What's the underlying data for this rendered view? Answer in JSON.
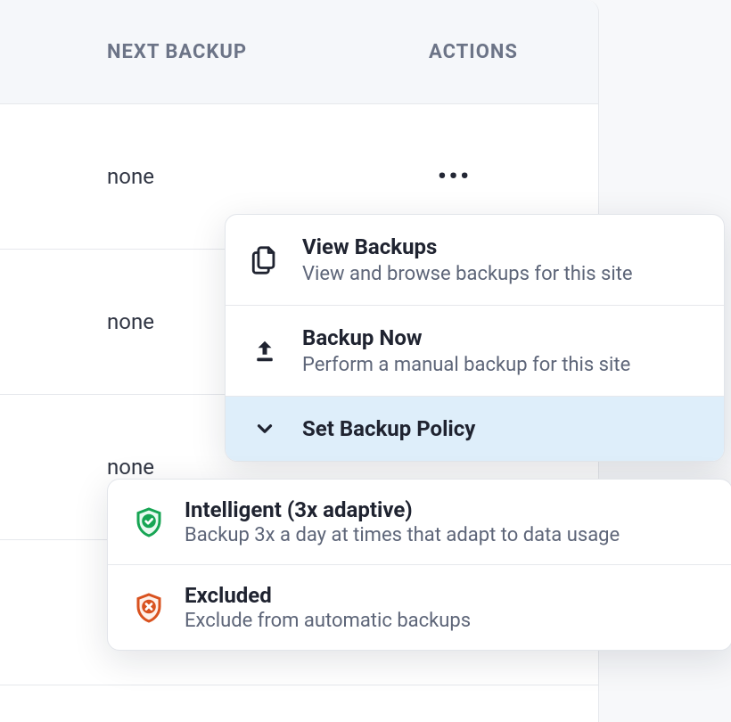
{
  "table": {
    "headers": {
      "next_backup": "NEXT BACKUP",
      "actions": "ACTIONS"
    },
    "rows": [
      {
        "next_backup": "none"
      },
      {
        "next_backup": "none"
      },
      {
        "next_backup": "none"
      },
      {
        "next_backup": ""
      }
    ]
  },
  "actions_menu": {
    "view_backups": {
      "title": "View Backups",
      "desc": "View and browse backups for this site"
    },
    "backup_now": {
      "title": "Backup Now",
      "desc": "Perform a manual backup for this site"
    },
    "set_policy": {
      "title": "Set Backup Policy"
    }
  },
  "policy_menu": {
    "intelligent": {
      "title": "Intelligent (3x adaptive)",
      "desc": "Backup 3x a day at times that adapt to data usage"
    },
    "excluded": {
      "title": "Excluded",
      "desc": "Exclude from automatic backups"
    }
  }
}
